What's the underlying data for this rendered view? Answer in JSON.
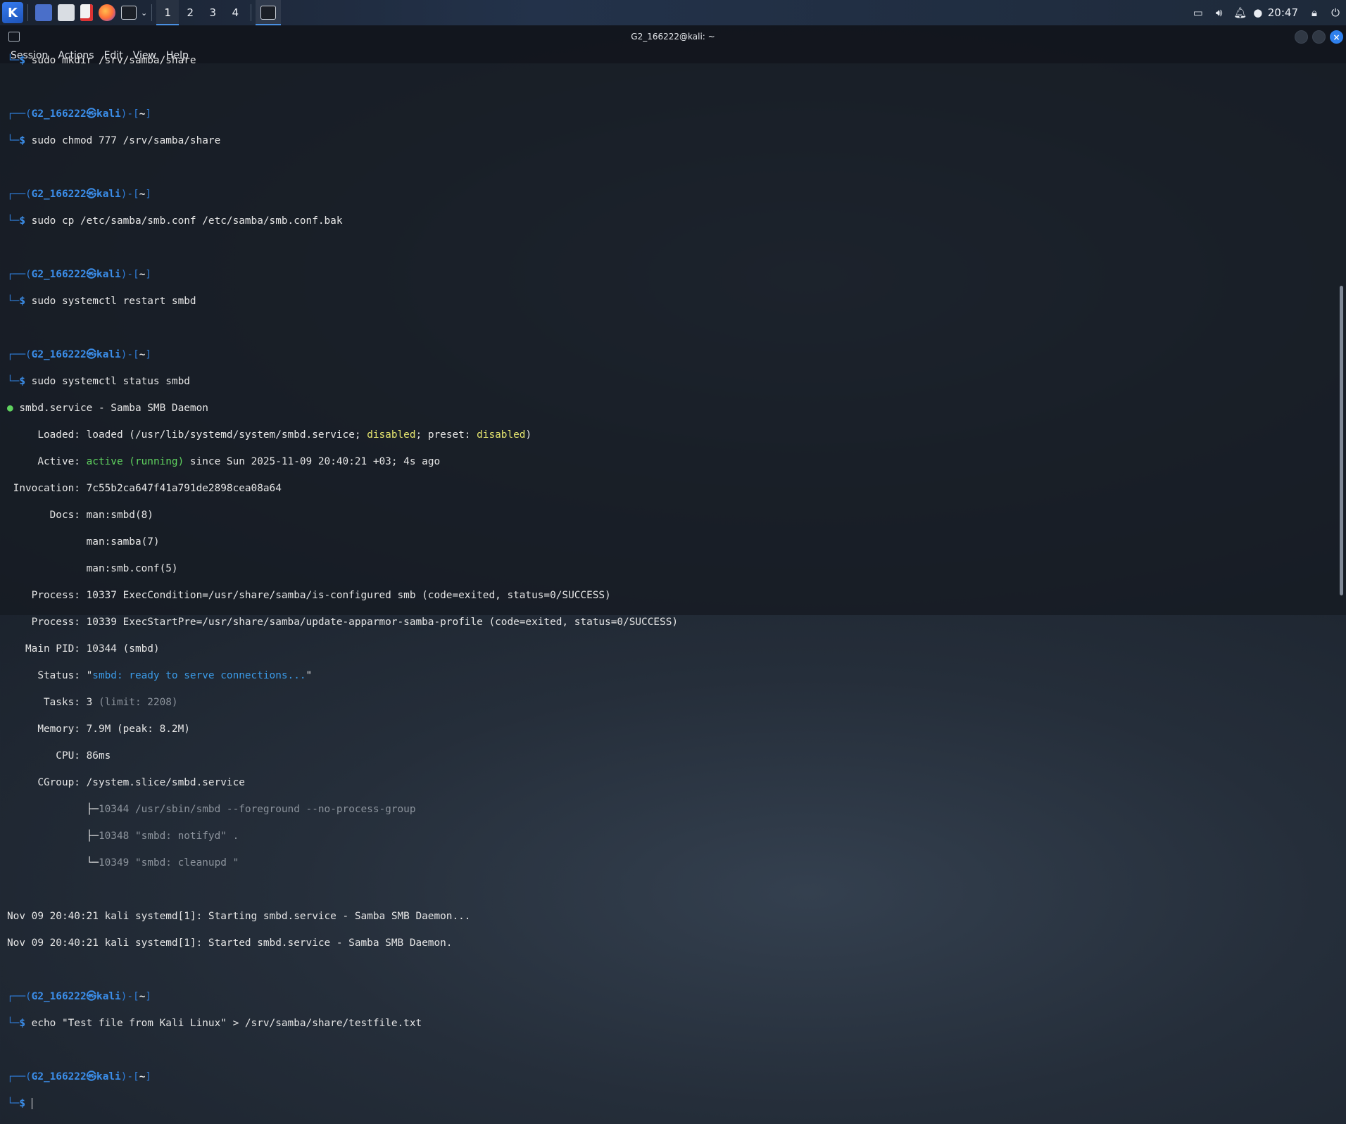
{
  "taskbar": {
    "workspaces": [
      "1",
      "2",
      "3",
      "4"
    ],
    "clock": "20:47",
    "colors": {
      "accent": "#367bf0"
    }
  },
  "window": {
    "title": "G2_166222@kali: ~",
    "menu": [
      "Session",
      "Actions",
      "Edit",
      "View",
      "Help"
    ]
  },
  "prompt": {
    "user": "G2_166222",
    "at": "㉿",
    "host": "kali",
    "dir": "~"
  },
  "terminal": {
    "cmd1": "sudo mkdir /srv/samba/share",
    "cmd2": "sudo chmod 777 /srv/samba/share",
    "cmd3": "sudo cp /etc/samba/smb.conf /etc/samba/smb.conf.bak",
    "cmd4": "sudo systemctl restart smbd",
    "cmd5": "sudo systemctl status smbd",
    "status": {
      "header": "smbd.service - Samba SMB Daemon",
      "loaded_label": "     Loaded: ",
      "loaded_pre": "loaded (/usr/lib/systemd/system/smbd.service; ",
      "loaded_state": "disabled",
      "loaded_mid": "; preset: ",
      "loaded_preset": "disabled",
      "loaded_post": ")",
      "active_label": "     Active: ",
      "active_state": "active (running)",
      "active_post": " since Sun 2025-11-09 20:40:21 +03; 4s ago",
      "invocation": " Invocation: 7c55b2ca647f41a791de2898cea08a64",
      "docs1": "       Docs: man:smbd(8)",
      "docs2": "             man:samba(7)",
      "docs3": "             man:smb.conf(5)",
      "process1": "    Process: 10337 ExecCondition=/usr/share/samba/is-configured smb (code=exited, status=0/SUCCESS)",
      "process2": "    Process: 10339 ExecStartPre=/usr/share/samba/update-apparmor-samba-profile (code=exited, status=0/SUCCESS)",
      "mainpid": "   Main PID: 10344 (smbd)",
      "status_label": "     Status: \"",
      "status_val": "smbd: ready to serve connections...",
      "status_end": "\"",
      "tasks_label": "      Tasks: 3 ",
      "tasks_limit": "(limit: 2208)",
      "memory": "     Memory: 7.9M (peak: 8.2M)",
      "cpu": "        CPU: 86ms",
      "cgroup": "     CGroup: /system.slice/smbd.service",
      "cg1_tree": "             ├─",
      "cg1": "10344 /usr/sbin/smbd --foreground --no-process-group",
      "cg2_tree": "             ├─",
      "cg2": "10348 \"smbd: notifyd\" .",
      "cg3_tree": "             └─",
      "cg3": "10349 \"smbd: cleanupd \""
    },
    "log1": "Nov 09 20:40:21 kali systemd[1]: Starting smbd.service - Samba SMB Daemon...",
    "log2": "Nov 09 20:40:21 kali systemd[1]: Started smbd.service - Samba SMB Daemon.",
    "cmd6": "echo \"Test file from Kali Linux\" > /srv/samba/share/testfile.txt"
  }
}
